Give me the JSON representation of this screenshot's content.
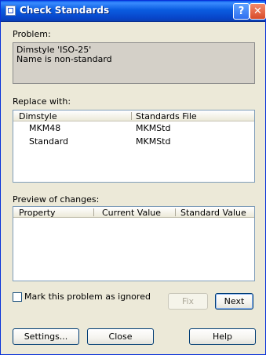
{
  "window": {
    "title": "Check Standards"
  },
  "problem": {
    "label": "Problem:",
    "line1": "Dimstyle 'ISO-25'",
    "line2": "Name is non-standard"
  },
  "replace": {
    "label": "Replace with:",
    "columns": [
      "Dimstyle",
      "Standards File"
    ],
    "rows": [
      [
        "MKM48",
        "MKMStd"
      ],
      [
        "Standard",
        "MKMStd"
      ]
    ]
  },
  "preview": {
    "label": "Preview of changes:",
    "columns": [
      "Property",
      "Current Value",
      "Standard Value"
    ]
  },
  "ignore_checkbox": {
    "label": "Mark this problem as ignored",
    "checked": false
  },
  "buttons": {
    "fix": "Fix",
    "next": "Next",
    "settings": "Settings...",
    "close": "Close",
    "help": "Help"
  },
  "icons": {
    "title": "standards-check-icon",
    "help": "question-mark-icon",
    "close": "close-x-icon"
  }
}
